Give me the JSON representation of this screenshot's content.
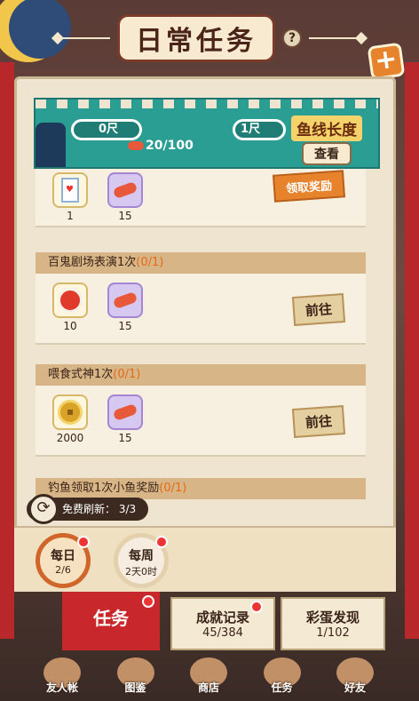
{
  "header": {
    "title": "日常任务",
    "help_icon": "?",
    "add_icon": "+"
  },
  "fishing": {
    "gauge_left": "0尺",
    "gauge_right": "1尺",
    "count": "20/100",
    "title": "鱼线长度",
    "view_label": "查看"
  },
  "tasks": [
    {
      "name": "",
      "progress": "",
      "rewards": [
        {
          "icon": "milk-carton-icon",
          "qty": "1"
        },
        {
          "icon": "bait-worm-icon",
          "qty": "15"
        }
      ],
      "action": "领取奖励"
    },
    {
      "name": "百鬼剧场表演1次",
      "progress": "(0/1)",
      "rewards": [
        {
          "icon": "red-scroll-icon",
          "qty": "10"
        },
        {
          "icon": "bait-worm-icon",
          "qty": "15"
        }
      ],
      "action": "前往"
    },
    {
      "name": "喂食式神1次",
      "progress": "(0/1)",
      "rewards": [
        {
          "icon": "gold-coin-icon",
          "qty": "2000"
        },
        {
          "icon": "bait-worm-icon",
          "qty": "15"
        }
      ],
      "action": "前往"
    },
    {
      "name": "钓鱼领取1次小鱼奖励",
      "progress": "(0/1)"
    }
  ],
  "refresh": {
    "label": "免费刷新：",
    "count": "3/3"
  },
  "period_tabs": [
    {
      "label": "每日",
      "sub": "2/6",
      "active": true
    },
    {
      "label": "每周",
      "sub": "2天0时",
      "active": false
    }
  ],
  "bottom_tabs": [
    {
      "label": "任务"
    },
    {
      "label": "成就记录",
      "sub": "45/384"
    },
    {
      "label": "彩蛋发现",
      "sub": "1/102"
    }
  ],
  "nav": [
    "友人帐",
    "图鉴",
    "商店",
    "任务",
    "好友"
  ]
}
